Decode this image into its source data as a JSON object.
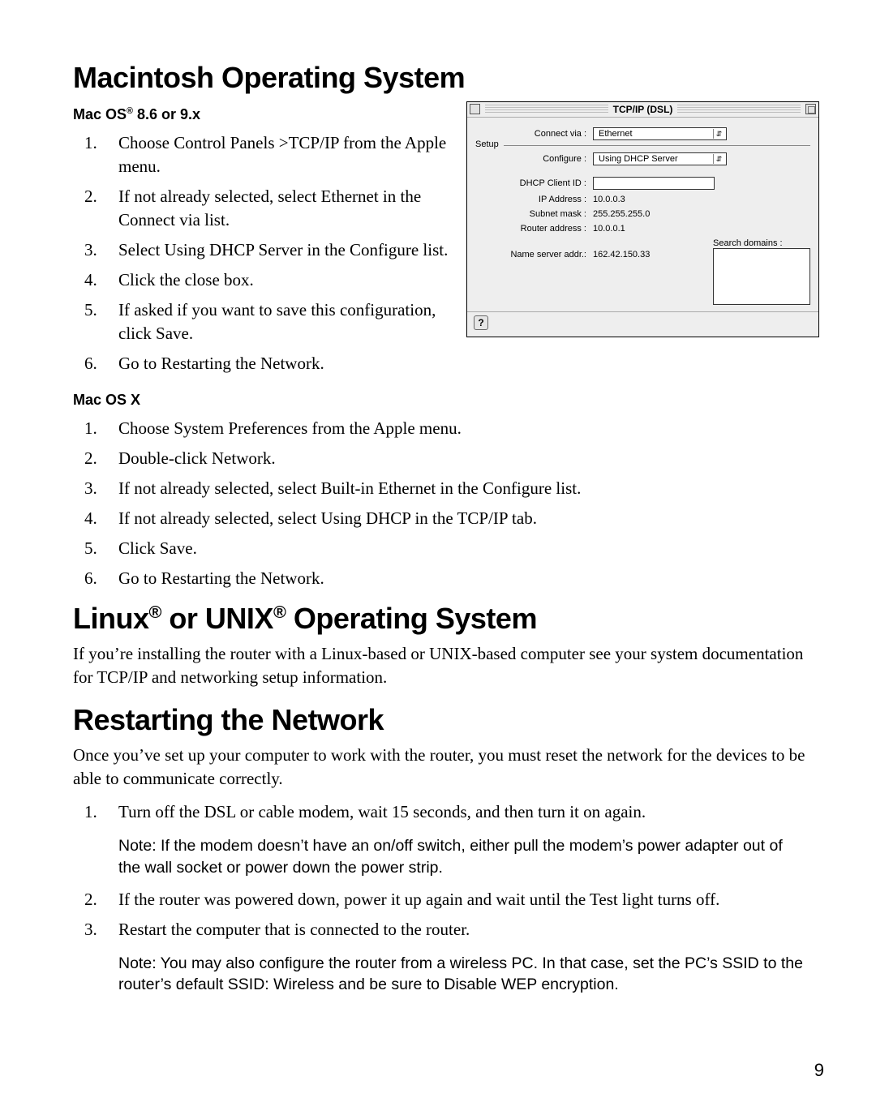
{
  "headings": {
    "mac": "Macintosh Operating System",
    "mac_os8": "Mac OS",
    "mac_os8_ver": " 8.6 or 9.x",
    "mac_osx": "Mac OS X",
    "linux": "Linux",
    "or_unix": " or UNIX",
    "os_tail": " Operating System",
    "restart": "Restarting the Network",
    "reg": "®"
  },
  "mac8_steps": [
    "Choose Control Panels >TCP/IP from the Apple menu.",
    "If not already selected, select Ethernet in the Connect via list.",
    "Select Using DHCP Server in the Configure list.",
    "Click the close box.",
    "If asked if you want to save this configuration, click Save.",
    "Go to Restarting the Network."
  ],
  "macx_steps": [
    "Choose System Preferences from the Apple menu.",
    "Double-click Network.",
    "If not already selected, select Built-in Ethernet in the Configure list.",
    "If not already selected, select Using DHCP in the TCP/IP tab.",
    "Click Save.",
    "Go to Restarting the Network."
  ],
  "linux_body": "If you’re installing the router with a Linux-based or UNIX-based computer see your system documentation for TCP/IP and networking setup information.",
  "restart_body": "Once you’ve set up your computer to work with the router, you must reset the network for the devices to be able to communicate correctly.",
  "restart_steps": [
    "Turn off the DSL or cable modem, wait 15 seconds, and then turn it on again.",
    "If the router was powered down, power it up again and wait until the Test light turns off.",
    "Restart the computer that is connected to the router."
  ],
  "notes": {
    "n1": "Note: If the modem doesn’t have an on/off switch, either pull the modem’s power adapter out of the wall socket or power down the power strip.",
    "n2": "Note: You may also configure the router from a wireless PC. In that case, set the PC’s SSID to the router’s default SSID: Wireless and be sure to Disable WEP encryption."
  },
  "dialog": {
    "title": "TCP/IP (DSL)",
    "setup_lbl": "Setup",
    "connect_lbl": "Connect via :",
    "connect_val": "Ethernet",
    "configure_lbl": "Configure :",
    "configure_val": "Using DHCP Server",
    "dhcp_lbl": "DHCP Client ID :",
    "ip_lbl": "IP Address :",
    "ip_val": "10.0.0.3",
    "subnet_lbl": "Subnet mask :",
    "subnet_val": "255.255.255.0",
    "router_lbl": "Router address :",
    "router_val": "10.0.0.1",
    "ns_lbl": "Name server addr.:",
    "ns_val": "162.42.150.33",
    "search_lbl": "Search domains :",
    "help": "?"
  },
  "page_number": "9",
  "arrow": "⇵"
}
